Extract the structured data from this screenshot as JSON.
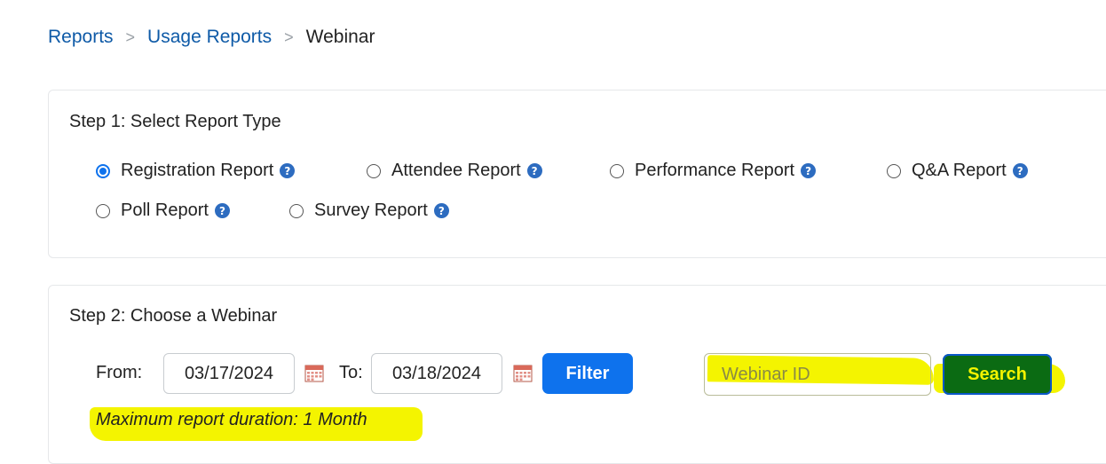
{
  "breadcrumb": {
    "items": [
      "Reports",
      "Usage Reports"
    ],
    "current": "Webinar",
    "separator": ">"
  },
  "step1": {
    "title": "Step 1: Select Report Type",
    "options": [
      {
        "label": "Registration Report",
        "checked": true
      },
      {
        "label": "Attendee Report",
        "checked": false
      },
      {
        "label": "Performance Report",
        "checked": false
      },
      {
        "label": "Q&A Report",
        "checked": false
      },
      {
        "label": "Poll Report",
        "checked": false
      },
      {
        "label": "Survey Report",
        "checked": false
      }
    ],
    "help_icon": "question-circle-icon"
  },
  "step2": {
    "title": "Step 2: Choose a Webinar",
    "from_label": "From:",
    "from_value": "03/17/2024",
    "to_label": "To:",
    "to_value": "03/18/2024",
    "calendar_icon": "calendar-icon",
    "filter_label": "Filter",
    "webinar_id_placeholder": "Webinar ID",
    "search_label": "Search",
    "note": "Maximum report duration: 1 Month"
  },
  "colors": {
    "accent": "#0e72ed",
    "link": "#0e5aa7",
    "highlight": "#f4f400",
    "help_icon": "#2d6cc0"
  }
}
